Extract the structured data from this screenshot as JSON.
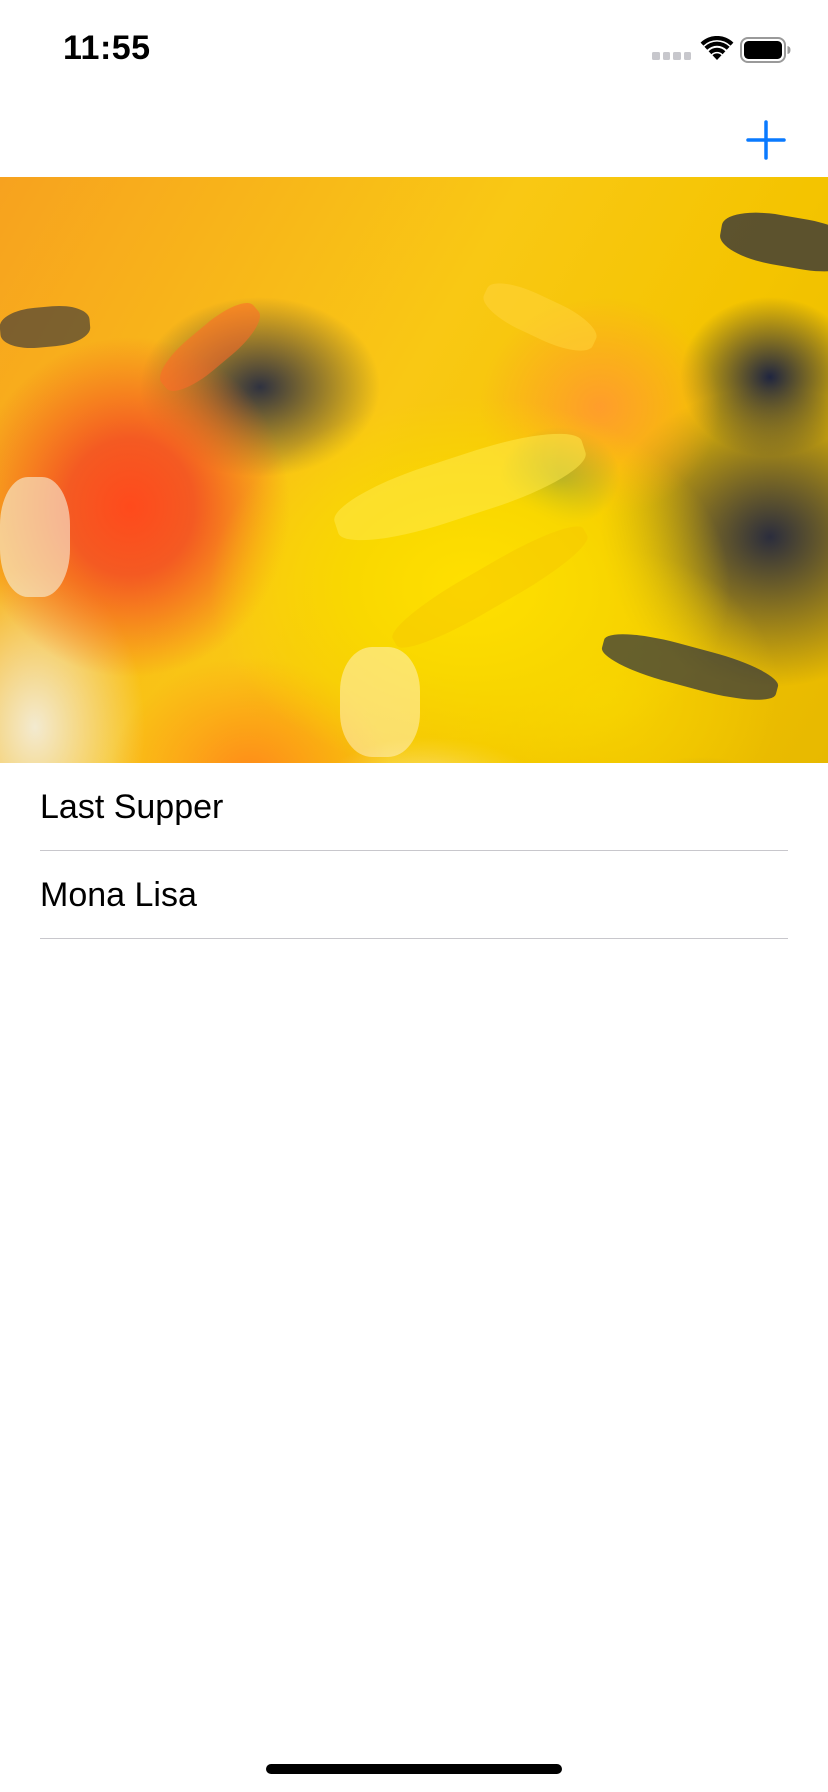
{
  "status_bar": {
    "time": "11:55"
  },
  "nav_bar": {
    "add_icon": "plus-icon",
    "accent_color": "#0a7aff"
  },
  "hero": {
    "description_icon": "abstract-oil-painting-image"
  },
  "list": {
    "items": [
      {
        "label": "Last Supper"
      },
      {
        "label": "Mona Lisa"
      }
    ]
  }
}
